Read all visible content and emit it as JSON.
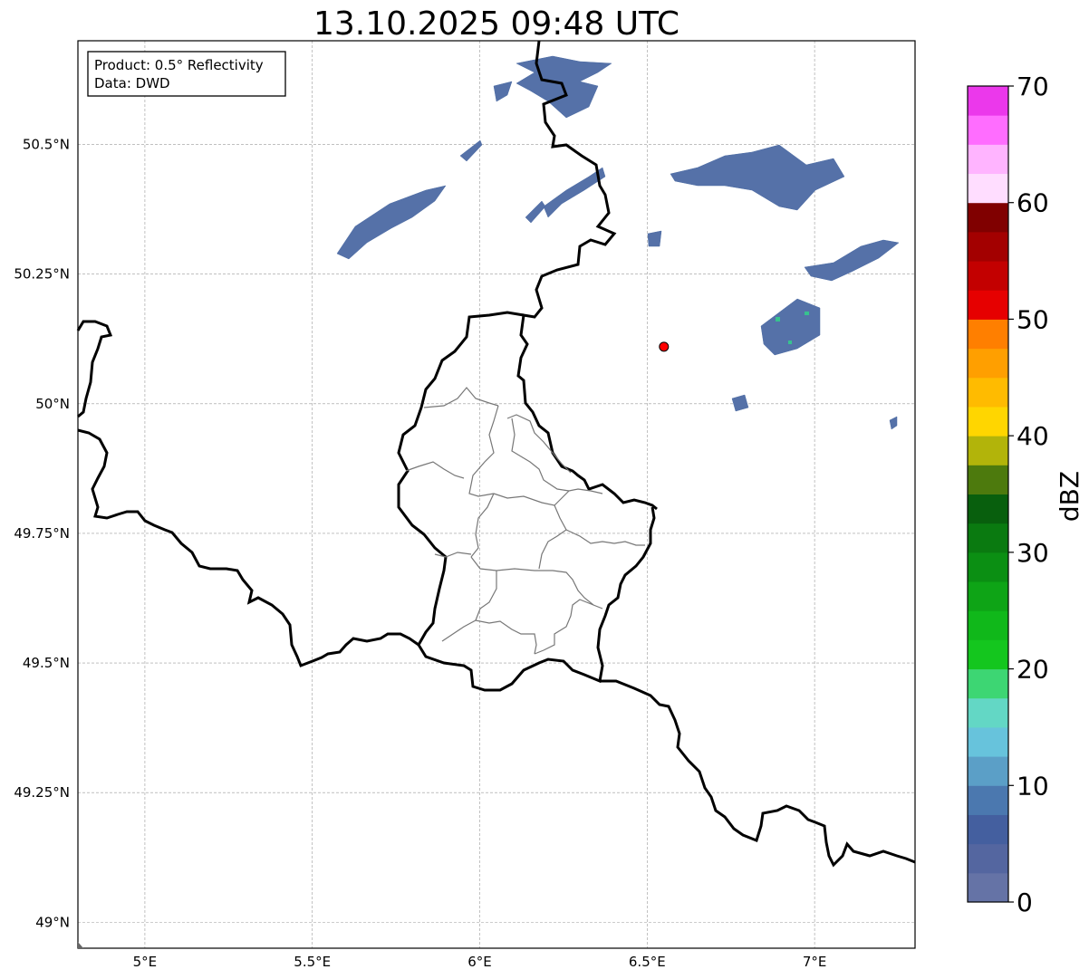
{
  "map": {
    "title": "13.10.2025 09:48 UTC",
    "info_box": {
      "product_line": "Product: 0.5° Reflectivity",
      "data_line": "Data: DWD"
    },
    "lat_ticks": [
      {
        "value": 50.5,
        "label": "50.5°N"
      },
      {
        "value": 50.25,
        "label": "50.25°N"
      },
      {
        "value": 50.0,
        "label": "50°N"
      },
      {
        "value": 49.75,
        "label": "49.75°N"
      },
      {
        "value": 49.5,
        "label": "49.5°N"
      },
      {
        "value": 49.25,
        "label": "49.25°N"
      },
      {
        "value": 49.0,
        "label": "49°N"
      }
    ],
    "lon_ticks": [
      {
        "value": 5.0,
        "label": "5°E"
      },
      {
        "value": 5.5,
        "label": "5.5°E"
      },
      {
        "value": 6.0,
        "label": "6°E"
      },
      {
        "value": 6.5,
        "label": "6.5°E"
      },
      {
        "value": 7.0,
        "label": "7°E"
      }
    ],
    "extent": {
      "lon_min": 4.8,
      "lon_max": 7.3,
      "lat_min": 48.95,
      "lat_max": 50.7
    },
    "radar_site": {
      "lon": 6.55,
      "lat": 50.11,
      "color": "#ff0000"
    }
  },
  "colorbar": {
    "label": "dBZ",
    "tick_labels": [
      "0",
      "10",
      "20",
      "30",
      "40",
      "50",
      "60",
      "70"
    ],
    "min": 0,
    "max": 70,
    "colors": [
      "#6573a6",
      "#5466a0",
      "#445f9f",
      "#4b78af",
      "#5b9fc7",
      "#67c3dc",
      "#63d7c5",
      "#3dd673",
      "#14c61e",
      "#10b81a",
      "#0ea416",
      "#0b8f13",
      "#0a7a10",
      "#085f0d",
      "#4d7a0d",
      "#b2b40a",
      "#ffd600",
      "#ffbb00",
      "#ff9f00",
      "#ff7f00",
      "#e60000",
      "#c30000",
      "#a30000",
      "#800000",
      "#ffddff",
      "#ffb4ff",
      "#ff6dff",
      "#eb38eb"
    ]
  }
}
